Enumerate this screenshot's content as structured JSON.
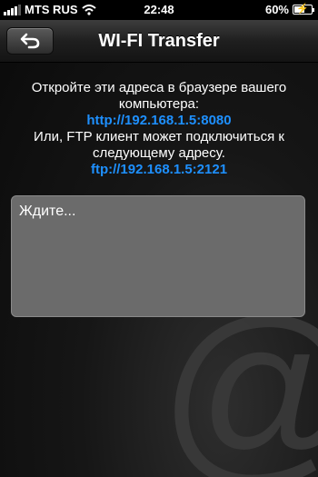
{
  "status_bar": {
    "carrier": "MTS RUS",
    "time": "22:48",
    "battery_percent": "60%",
    "battery_level": 0.6,
    "wifi_icon": "wifi-icon",
    "signal_icon": "signal-bars-icon"
  },
  "nav": {
    "title": "WI-FI Transfer",
    "back_icon": "back-arrow-icon"
  },
  "info": {
    "line1": "Откройте эти адреса в браузере вашего компьютера:",
    "http_url": "http://192.168.1.5:8080",
    "line2": "Или, FTP клиент может подключиться к следующему адресу.",
    "ftp_url": "ftp://192.168.1.5:2121"
  },
  "log": {
    "text": "Ждите..."
  },
  "watermark": {
    "glyph": "@"
  },
  "colors": {
    "link": "#1e90ff",
    "background": "#161616",
    "log_box": "#6b6b6b"
  }
}
